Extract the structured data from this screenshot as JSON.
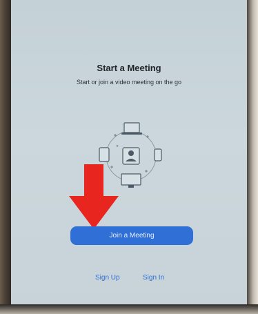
{
  "screen": {
    "title": "Start a Meeting",
    "subtitle": "Start or join a video meeting on the go"
  },
  "actions": {
    "join_label": "Join a Meeting",
    "sign_up_label": "Sign Up",
    "sign_in_label": "Sign In"
  },
  "illustration": {
    "icons": [
      "laptop-icon",
      "tablet-icon",
      "user-icon",
      "phone-icon",
      "monitor-icon"
    ]
  },
  "annotation": {
    "icon": "arrow-down-icon",
    "color": "#e8261f"
  },
  "colors": {
    "accent": "#2f6fd6",
    "screen_bg": "#c8d4d9"
  }
}
